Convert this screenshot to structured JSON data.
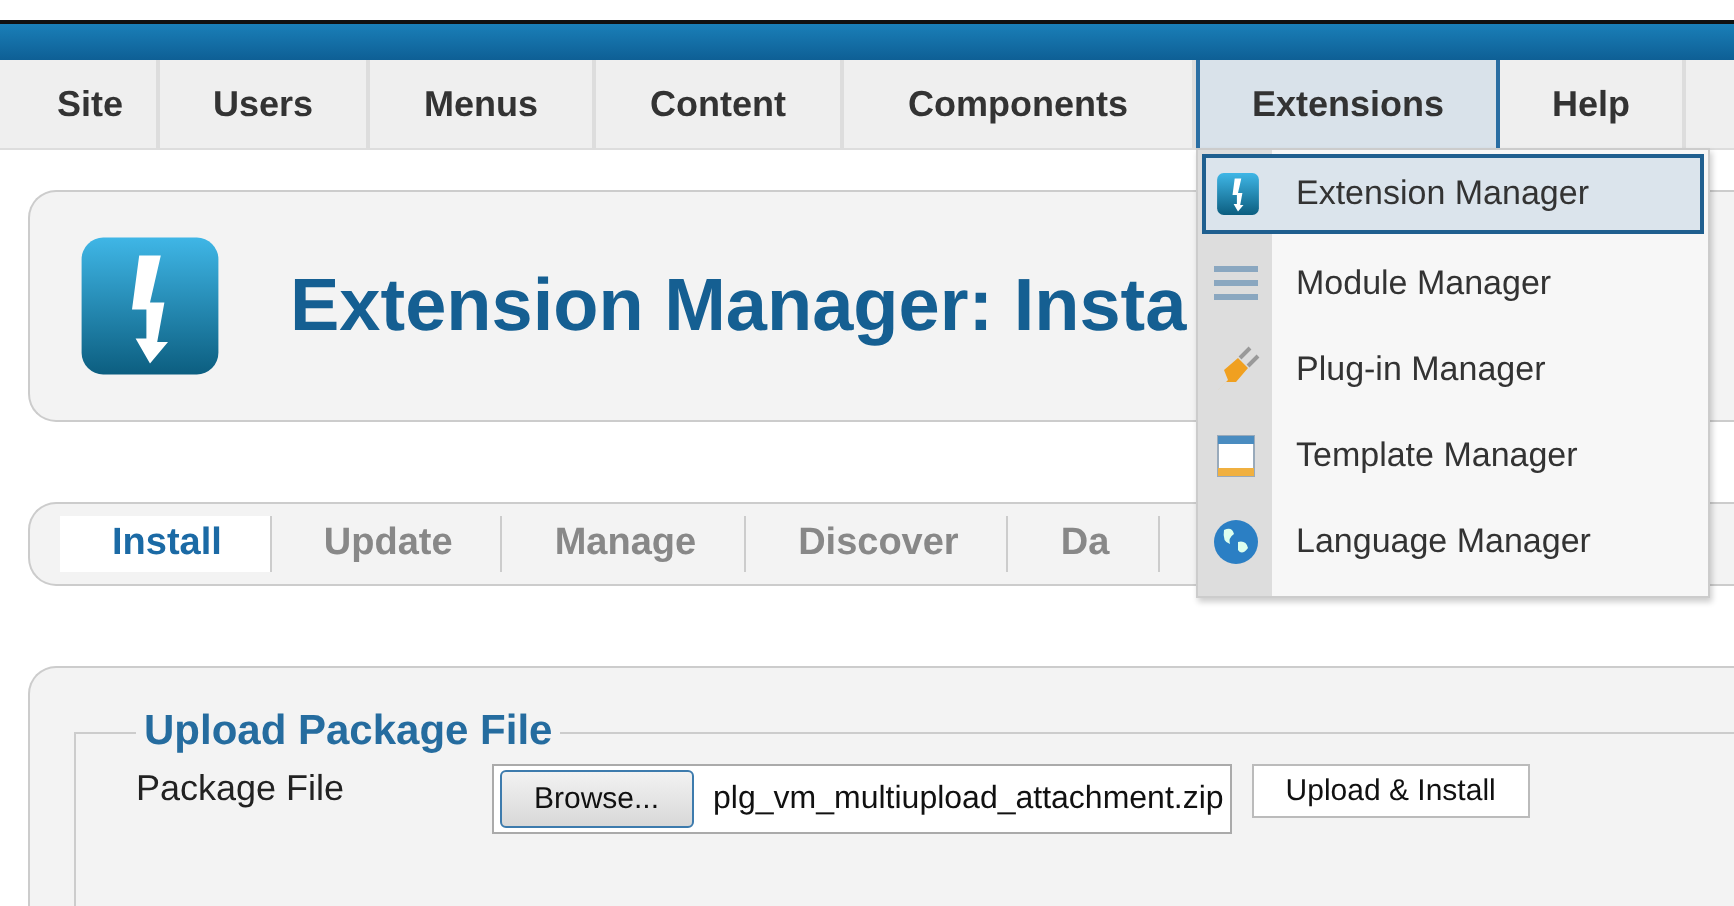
{
  "menu": [
    {
      "label": "Site",
      "selected": false
    },
    {
      "label": "Users",
      "selected": false
    },
    {
      "label": "Menus",
      "selected": false
    },
    {
      "label": "Content",
      "selected": false
    },
    {
      "label": "Components",
      "selected": false
    },
    {
      "label": "Extensions",
      "selected": true
    },
    {
      "label": "Help",
      "selected": false
    }
  ],
  "dropdown": [
    {
      "label": "Extension Manager",
      "kind": "extension",
      "selected": true
    },
    {
      "label": "Module Manager",
      "kind": "module",
      "selected": false
    },
    {
      "label": "Plug-in Manager",
      "kind": "plugin",
      "selected": false
    },
    {
      "label": "Template Manager",
      "kind": "template",
      "selected": false
    },
    {
      "label": "Language Manager",
      "kind": "language",
      "selected": false
    }
  ],
  "header": {
    "title": "Extension Manager: Insta"
  },
  "subtabs": [
    {
      "label": "Install",
      "selected": true
    },
    {
      "label": "Update",
      "selected": false
    },
    {
      "label": "Manage",
      "selected": false
    },
    {
      "label": "Discover",
      "selected": false
    },
    {
      "label": "Da",
      "selected": false
    }
  ],
  "upload": {
    "legend": "Upload Package File",
    "label": "Package File",
    "browse": "Browse...",
    "file": "plg_vm_multiupload_attachment.zip",
    "submit": "Upload & Install"
  }
}
